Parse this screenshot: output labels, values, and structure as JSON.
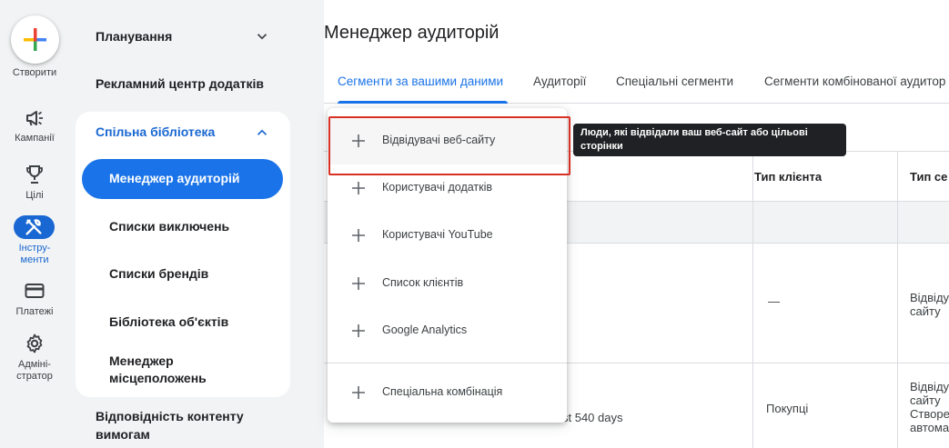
{
  "rail": {
    "create_label": "Створити",
    "items": [
      {
        "label": "Кампанії",
        "icon": "megaphone-icon"
      },
      {
        "label": "Цілі",
        "icon": "trophy-icon"
      },
      {
        "label": "Інстру-\nменти",
        "line1": "Інстру-",
        "line2": "менти",
        "icon": "tools-icon"
      },
      {
        "label": "Платежі",
        "icon": "credit-card-icon"
      },
      {
        "label": "Адміні-\nстратор",
        "line1": "Адміні-",
        "line2": "стратор",
        "icon": "gear-icon"
      }
    ]
  },
  "nav": {
    "planning": "Планування",
    "app_ad_hub": "Рекламний центр додатків",
    "shared_library": "Спільна бібліотека",
    "audience_manager": "Менеджер аудиторій",
    "exclusion_lists": "Списки виключень",
    "brand_lists": "Списки брендів",
    "asset_library": "Бібліотека об'єктів",
    "location_manager_line1": "Менеджер",
    "location_manager_line2": "місцеположень",
    "policy_line1": "Відповідність контенту",
    "policy_line2": "вимогам"
  },
  "main": {
    "title": "Менеджер аудиторій",
    "tabs": [
      {
        "label": "Сегменти за вашими даними",
        "active": true
      },
      {
        "label": "Аудиторії",
        "active": false
      },
      {
        "label": "Спеціальні сегменти",
        "active": false
      },
      {
        "label": "Сегменти комбінованої аудитор",
        "active": false
      }
    ]
  },
  "table": {
    "headers": [
      "Тип клієнта",
      "Тип се"
    ],
    "row1": {
      "client_type": "—",
      "segment_line1": "Відвіду",
      "segment_line2": "сайту"
    },
    "row2": {
      "partial_text": "st 540 days",
      "client_type": "Покупці",
      "segment_line1": "Відвіду",
      "segment_line2": "сайту",
      "segment_line3": "Створе",
      "segment_line4": "автома"
    }
  },
  "menu": {
    "items": [
      {
        "label": "Відвідувачі веб-сайту"
      },
      {
        "label": "Користувачі додатків"
      },
      {
        "label": "Користувачі YouTube"
      },
      {
        "label": "Список клієнтів"
      },
      {
        "label": "Google Analytics"
      }
    ],
    "custom_combination": "Спеціальна комбінація"
  },
  "tooltip": {
    "line1": "Люди, які відвідали ваш веб-сайт або цільові",
    "line2": "сторінки"
  },
  "colors": {
    "accent": "#1a73e8",
    "highlight": "#d93025",
    "rail_bg": "#f1f3f4"
  }
}
